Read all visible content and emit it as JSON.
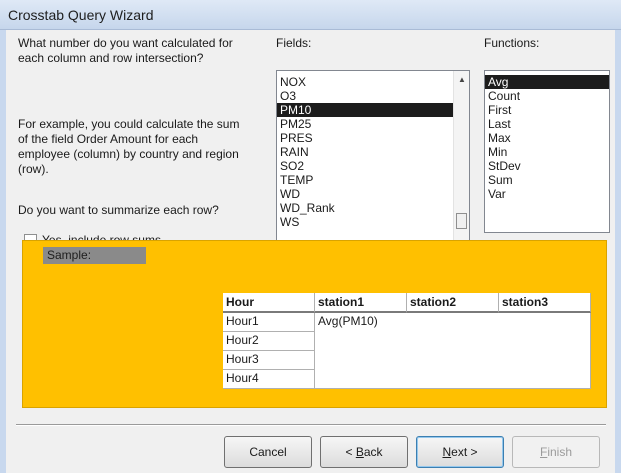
{
  "window": {
    "title": "Crosstab Query Wizard"
  },
  "instructions": {
    "question_line1": "What number do you want calculated for",
    "question_line2": "each column and row intersection?",
    "example_line1": "For example, you could calculate the sum",
    "example_line2": "of the field Order Amount for each",
    "example_line3": "employee (column)  by country and region",
    "example_line4": "(row).",
    "summarize": "Do you want to summarize each row?",
    "row_sums_label": "Yes, include row sums.",
    "row_sums_checked": false
  },
  "fields": {
    "label": "Fields:",
    "items": [
      "NOX",
      "O3",
      "PM10",
      "PM25",
      "PRES",
      "RAIN",
      "SO2",
      "TEMP",
      "WD",
      "WD_Rank",
      "WS"
    ],
    "selected": "PM10"
  },
  "functions": {
    "label": "Functions:",
    "items": [
      "Avg",
      "Count",
      "First",
      "Last",
      "Max",
      "Min",
      "StDev",
      "Sum",
      "Var"
    ],
    "selected": "Avg"
  },
  "sample": {
    "label": "Sample:",
    "corner_header": "Hour",
    "column_headers": [
      "station1",
      "station2",
      "station3"
    ],
    "row_headers": [
      "Hour1",
      "Hour2",
      "Hour3",
      "Hour4"
    ],
    "value": "Avg(PM10)"
  },
  "buttons": {
    "cancel": "Cancel",
    "back": "< Back",
    "next": "Next >",
    "finish": "Finish"
  },
  "colors": {
    "sample_background": "#ffc000",
    "selection": "#1c1c1c"
  }
}
